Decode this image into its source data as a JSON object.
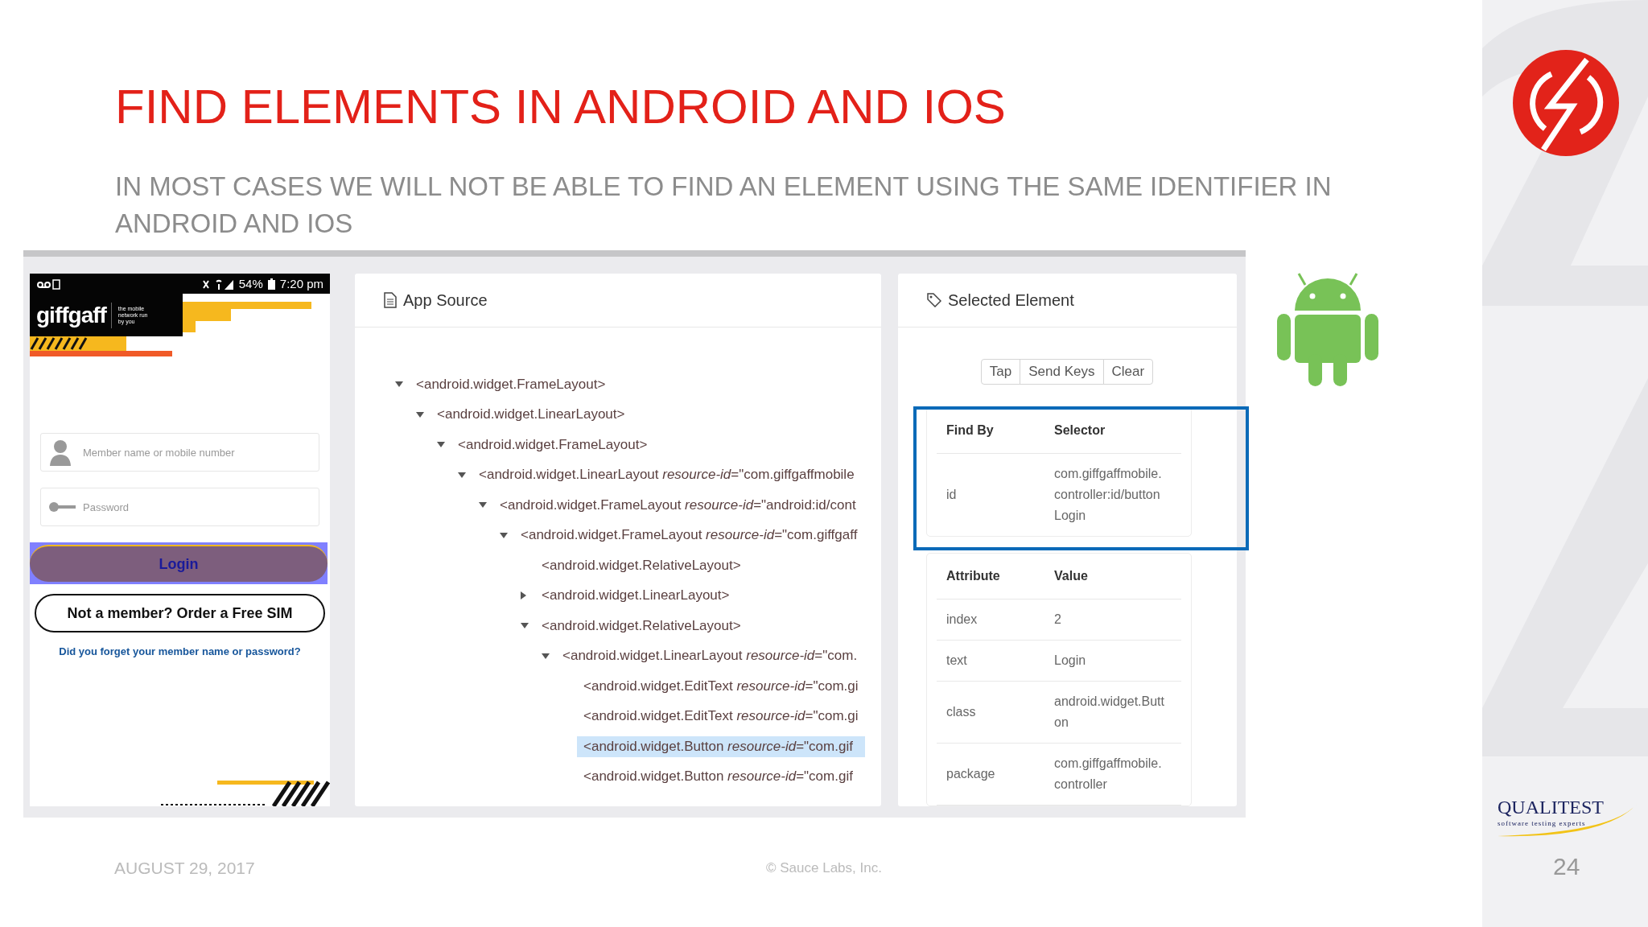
{
  "slide": {
    "title": "FIND ELEMENTS IN ANDROID AND IOS",
    "subtitle": "IN MOST CASES WE WILL NOT BE ABLE TO FIND AN ELEMENT USING THE SAME IDENTIFIER IN ANDROID AND IOS",
    "date": "AUGUST 29, 2017",
    "copyright": "© Sauce Labs, Inc.",
    "page_number": "24"
  },
  "logo": {
    "name": "QUALITEST",
    "tagline": "software testing experts"
  },
  "phone": {
    "status": {
      "battery": "54%",
      "time": "7:20 pm"
    },
    "brand": "giffgaff",
    "brand_tagline": "the mobile network run by you",
    "fields": [
      {
        "kind": "user",
        "placeholder": "Member name or mobile number"
      },
      {
        "kind": "password",
        "placeholder": "Password"
      }
    ],
    "login_button": {
      "label": "Login",
      "highlighted": true
    },
    "order_button": "Not a member? Order a Free SIM",
    "forgot_link": "Did you forget your member name or password?"
  },
  "app_source": {
    "title": "App Source",
    "tree": [
      {
        "label": "<android.widget.FrameLayout>",
        "expanded": true,
        "selected": false,
        "children": [
          {
            "label": "<android.widget.LinearLayout>",
            "expanded": true,
            "selected": false,
            "children": [
              {
                "label": "<android.widget.FrameLayout>",
                "expanded": true,
                "selected": false,
                "children": [
                  {
                    "label": "<android.widget.LinearLayout *resource-id*=\"com.giffgaffmobile",
                    "expanded": true,
                    "selected": false,
                    "children": [
                      {
                        "label": "<android.widget.FrameLayout *resource-id*=\"android:id/cont",
                        "expanded": true,
                        "selected": false,
                        "children": [
                          {
                            "label": "<android.widget.FrameLayout *resource-id*=\"com.giffgaff",
                            "expanded": true,
                            "selected": false,
                            "children": [
                              {
                                "label": "<android.widget.RelativeLayout>",
                                "selected": false
                              },
                              {
                                "label": "<android.widget.LinearLayout>",
                                "expanded": false,
                                "selected": false
                              },
                              {
                                "label": "<android.widget.RelativeLayout>",
                                "expanded": true,
                                "selected": false,
                                "children": [
                                  {
                                    "label": "<android.widget.LinearLayout *resource-id*=\"com.",
                                    "expanded": true,
                                    "selected": false,
                                    "children": [
                                      {
                                        "label": "<android.widget.EditText *resource-id*=\"com.gi",
                                        "selected": false
                                      },
                                      {
                                        "label": "<android.widget.EditText *resource-id*=\"com.gi",
                                        "selected": false
                                      },
                                      {
                                        "label": "<android.widget.Button *resource-id*=\"com.gif",
                                        "selected": true
                                      },
                                      {
                                        "label": "<android.widget.Button *resource-id*=\"com.gif",
                                        "selected": false
                                      }
                                    ]
                                  }
                                ]
                              }
                            ]
                          }
                        ]
                      }
                    ]
                  }
                ]
              }
            ]
          }
        ]
      }
    ]
  },
  "selected_element": {
    "title": "Selected Element",
    "actions": [
      "Tap",
      "Send Keys",
      "Clear"
    ],
    "find_by": {
      "highlighted": true,
      "columns": [
        "Find By",
        "Selector"
      ],
      "rows": [
        {
          "strategy": "id",
          "selector": "com.giffgaffmobile.controller:id/buttonLogin"
        }
      ]
    },
    "attributes": {
      "columns": [
        "Attribute",
        "Value"
      ],
      "rows": [
        {
          "name": "index",
          "value": "2"
        },
        {
          "name": "text",
          "value": "Login"
        },
        {
          "name": "class",
          "value": "android.widget.Button"
        },
        {
          "name": "package",
          "value": "com.giffgaffmobile.controller"
        }
      ]
    }
  }
}
